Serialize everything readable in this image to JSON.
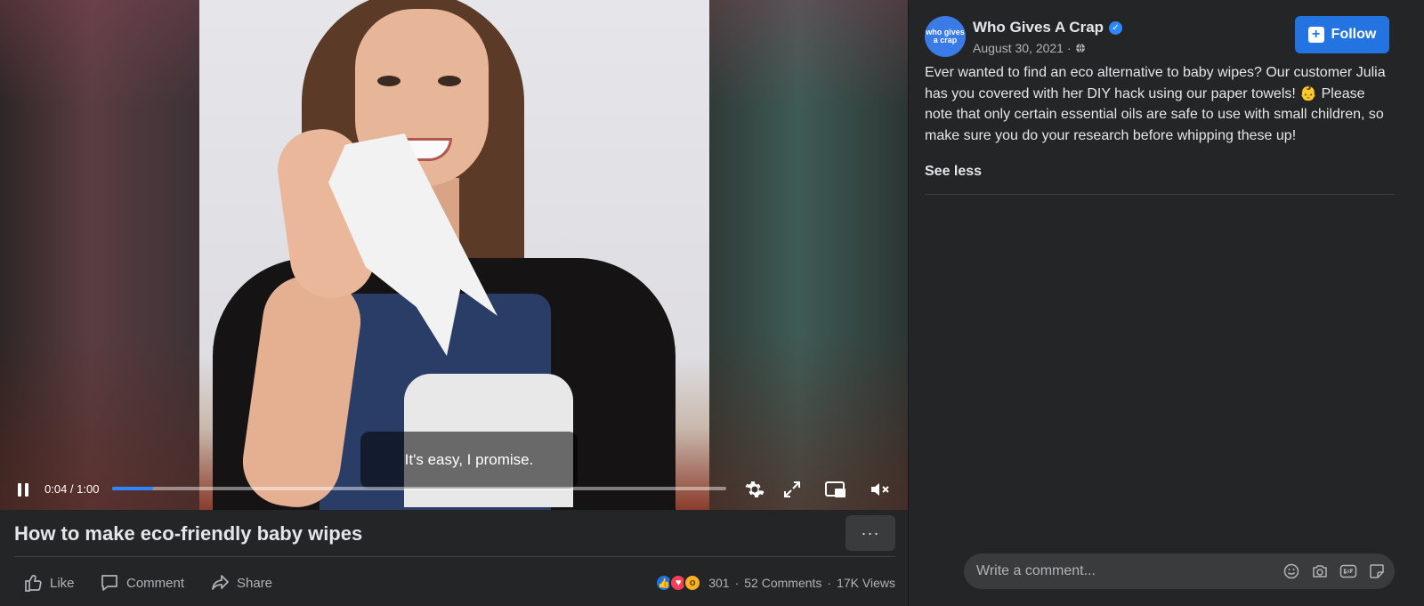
{
  "video": {
    "caption": "It's easy, I promise.",
    "current_time": "0:04",
    "duration": "1:00",
    "time_display": "0:04 / 1:00",
    "progress_fraction": 0.067,
    "title": "How to make eco-friendly baby wipes",
    "more_label": "···"
  },
  "actions": {
    "like_label": "Like",
    "comment_label": "Comment",
    "share_label": "Share"
  },
  "stats": {
    "reaction_count": "301",
    "comments": "52 Comments",
    "views": "17K Views",
    "reaction_types": [
      "like-icon",
      "love-icon",
      "wow-icon"
    ]
  },
  "post": {
    "page_name": "Who Gives A Crap",
    "avatar_text": "who gives a crap",
    "verified": true,
    "date": "August 30, 2021 ·",
    "audience_icon": "globe-icon",
    "follow_label": "Follow",
    "text": "Ever wanted to find an eco alternative to baby wipes? Our customer Julia has you covered with her DIY hack using our paper towels! 👶 Please note that only certain essential oils are safe to use with small children, so make sure you do your research before whipping these up!",
    "see_less_label": "See less"
  },
  "comment_box": {
    "placeholder": "Write a comment..."
  },
  "colors": {
    "background": "#242526",
    "accent": "#2374e1",
    "progress": "#2d88ff",
    "text_primary": "#e4e6eb",
    "text_secondary": "#b0b3b8"
  }
}
